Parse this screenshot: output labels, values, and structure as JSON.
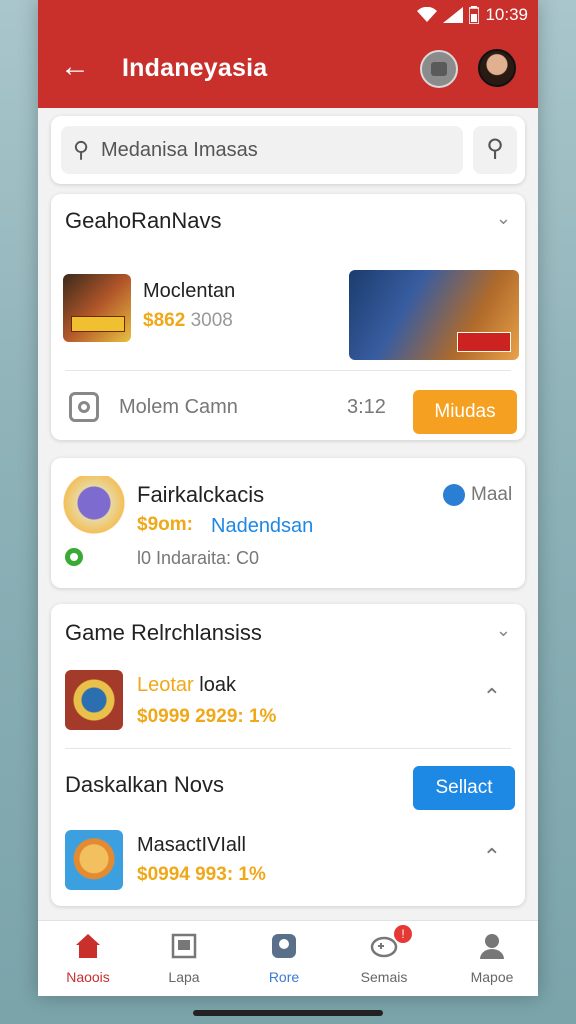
{
  "status": {
    "time": "10:39"
  },
  "appbar": {
    "title": "Indaneyasia"
  },
  "search": {
    "placeholder": "Medanisa Imasas"
  },
  "section1": {
    "title": "GeahoRanNavs",
    "item": {
      "name": "Moclentan",
      "price": "$862",
      "price_rest": "3008"
    },
    "footer": {
      "label": "Molem Camn",
      "value": "3:12",
      "button": "Miudas"
    }
  },
  "section2": {
    "title": "Fairkalckacis",
    "price": "$9om:",
    "subtitle": "Nadendsan",
    "meta": "l0 Indaraita: C0",
    "side_label": "Maal"
  },
  "section3": {
    "title": "Game Relrchlansiss",
    "item1": {
      "name_a": "Leotar",
      "name_b": "loak",
      "price": "$0999 2929: 1%"
    },
    "subtitle": "Daskalkan Novs",
    "select_button": "Sellact",
    "item2": {
      "name": "MasactIVIall",
      "price": "$0994 993: 1%"
    }
  },
  "nav": {
    "items": [
      {
        "label": "Naoois"
      },
      {
        "label": "Lapa"
      },
      {
        "label": "Rore"
      },
      {
        "label": "Semais",
        "badge": "!"
      },
      {
        "label": "Mapoe"
      }
    ]
  },
  "colors": {
    "primary": "#c9302c",
    "accent_orange": "#f5a020",
    "accent_blue": "#1e88e5",
    "price_gold": "#f0a818"
  }
}
